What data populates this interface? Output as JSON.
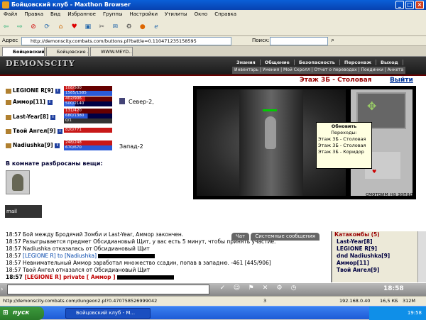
{
  "window": {
    "title": "Бойцовский клуб - Maxthon Browser"
  },
  "menu": [
    "Файл",
    "Правка",
    "Вид",
    "Избранное",
    "Группы",
    "Настройки",
    "Утилиты",
    "Окно",
    "Справка"
  ],
  "address": {
    "label": "Адрес",
    "url": "http://demonscity.combats.com/buttons.pl?battle=0.110471235158595",
    "search_label": "Поиск:"
  },
  "tabs": [
    "Бойцовский ...",
    "Бойцовские ...",
    "WWW.MEYD..."
  ],
  "game": {
    "logo": "DEMONSCITY",
    "nav_main": [
      "Знания",
      "Общение",
      "Безопасность",
      "Персонаж",
      "Выход"
    ],
    "nav_sub": "Инвентарь | Умения | Мой Скролл | Отчет о переводах | Поединки | Анкета",
    "location": "Этаж 3Б - Столовая",
    "exit_label": "Выйти",
    "players": [
      {
        "name": "LEGIONE R",
        "level": "[9]",
        "hp": "108/500",
        "mana": "1585/1585",
        "hp_frac": 0.22,
        "mana_frac": 1.0,
        "note": ""
      },
      {
        "name": "Аммор",
        "level": "[11]",
        "hp": "402/906",
        "mana": "500/2140",
        "hp_frac": 0.44,
        "mana_frac": 0.23,
        "note": "Север-2,"
      },
      {
        "name": "Last-Year",
        "level": "[8]",
        "hp": "131/420",
        "mana": "680/1380",
        "extra": "0/1",
        "hp_frac": 0.31,
        "mana_frac": 0.49,
        "note": ""
      },
      {
        "name": "Твой Ангел",
        "level": "[9]",
        "hp": "820/771",
        "hp_frac": 1.0,
        "note": ""
      },
      {
        "name": "Nadiushka",
        "level": "[9]",
        "hp": "248/248",
        "mana": "670/670",
        "hp_frac": 1.0,
        "mana_frac": 1.0,
        "note": "Запад-2"
      }
    ],
    "items_heading": "В комнате разбросаны вещи:",
    "counter_label": "mail",
    "tooltip": [
      "Обновить",
      "Переходы:",
      "Этаж 3Б - Столовая",
      "Этаж 3Б - Столовая",
      "Этаж 3Б - Коридор"
    ],
    "view_caption": "смотрим на запад"
  },
  "chat": {
    "tabs": [
      "Чат",
      "Системные сообщения"
    ],
    "lines": [
      {
        "time": "18:57",
        "text": "Бой между Бродячий Зомби и Last-Year, Аммор закончен."
      },
      {
        "time": "18:57",
        "text": "Разыгрывается предмет Обсидиановый Щит, у вас есть 5 минут, чтобы принять участие."
      },
      {
        "time": "18:57",
        "text": "Nadiushka отказалась от Обсидиановый Щит"
      },
      {
        "time": "18:57",
        "text": "[LEGIONE R] to [Nadiushka]"
      },
      {
        "time": "18:57",
        "text": "Невнимательный Аммор заработал множество ссадин, попав в западню. -461 [445/906]"
      },
      {
        "time": "18:57",
        "text": "Твой Ангел отказался от Обсидиановый Щит"
      },
      {
        "time": "18:57",
        "text": "[LEGIONE R] private [ Аммор ]"
      }
    ],
    "room_title": "Катакомбы (5)",
    "online": [
      "Last-Year[8]",
      "LEGIONE R[9]",
      "dnd Nadiushka[9]",
      "Аммор[11]",
      "Твой Ангел[9]"
    ],
    "clock": "18:58"
  },
  "status": {
    "url": "http://demonscity.combats.com/dungeon2.pl?0.470758526999042",
    "ip": "192.168.0.40",
    "speed": "16,5 КБ",
    "mem": "312М",
    "zoom": "3"
  },
  "taskbar": {
    "start": "пуск",
    "item": "Бойцовский клуб - M...",
    "time": "19:58"
  }
}
